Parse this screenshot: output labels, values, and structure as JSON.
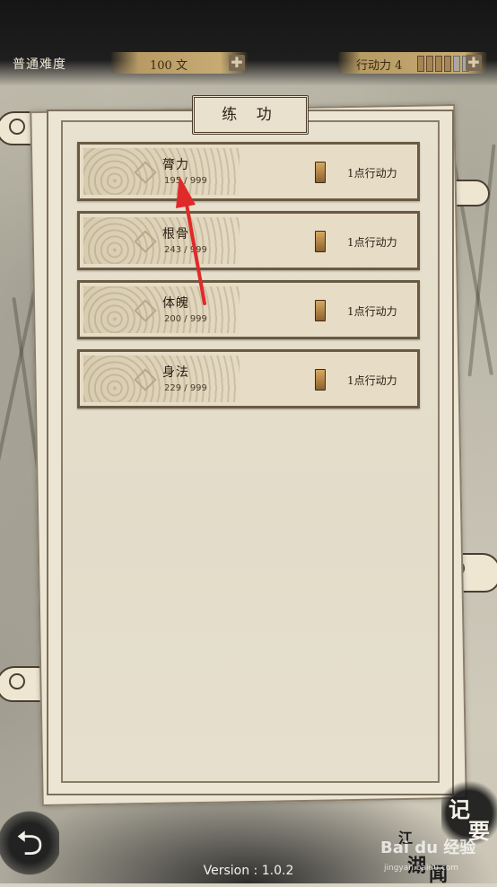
{
  "header": {
    "difficulty": "普通难度",
    "money": "100 文",
    "action_points_label": "行动力 4",
    "action_points": {
      "filled": 4,
      "total": 6
    }
  },
  "panel": {
    "title": "练 功"
  },
  "skills": [
    {
      "name": "膂力",
      "value": "195 / 999",
      "cost": "1点行动力"
    },
    {
      "name": "根骨",
      "value": "243 / 999",
      "cost": "1点行动力"
    },
    {
      "name": "体魄",
      "value": "200 / 999",
      "cost": "1点行动力"
    },
    {
      "name": "身法",
      "value": "229 / 999",
      "cost": "1点行动力"
    }
  ],
  "footer": {
    "version": "Version : 1.0.2",
    "notes_button": [
      "记",
      "要"
    ],
    "news_button": [
      "江",
      "湖",
      "闻"
    ]
  },
  "watermark": {
    "main": "Bai du 经验",
    "sub": "jingyan.baidu.com"
  },
  "colors": {
    "ink": "#1e1e1e",
    "paper": "#ece5d4",
    "border_brown": "#6a5a42",
    "annotation_red": "#e02a2a"
  }
}
